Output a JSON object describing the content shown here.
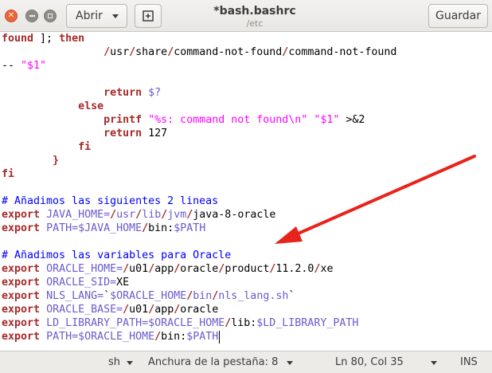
{
  "window": {
    "title": "*bash.bashrc",
    "subtitle": "/etc"
  },
  "header": {
    "open_label": "Abrir",
    "save_label": "Guardar"
  },
  "editor": {
    "lines": [
      [
        [
          "kw",
          "found"
        ],
        [
          "plain",
          " ]; "
        ],
        [
          "kw",
          "then"
        ]
      ],
      [
        [
          "plain",
          "                "
        ],
        [
          "kw",
          "/"
        ],
        [
          "plain",
          "usr"
        ],
        [
          "kw",
          "/"
        ],
        [
          "plain",
          "share"
        ],
        [
          "kw",
          "/"
        ],
        [
          "plain",
          "command-not-found"
        ],
        [
          "kw",
          "/"
        ],
        [
          "plain",
          "command-not-found"
        ]
      ],
      [
        [
          "plain",
          "-- "
        ],
        [
          "str",
          "\"$1\""
        ]
      ],
      [
        [
          "plain",
          ""
        ]
      ],
      [
        [
          "plain",
          "                "
        ],
        [
          "kw",
          "return"
        ],
        [
          "plain",
          " "
        ],
        [
          "var",
          "$?"
        ]
      ],
      [
        [
          "plain",
          "            "
        ],
        [
          "kw",
          "else"
        ]
      ],
      [
        [
          "plain",
          "                "
        ],
        [
          "kw",
          "printf"
        ],
        [
          "plain",
          " "
        ],
        [
          "str",
          "\"%s: command not found\\n\""
        ],
        [
          "plain",
          " "
        ],
        [
          "str",
          "\"$1\""
        ],
        [
          "plain",
          " >&2"
        ]
      ],
      [
        [
          "plain",
          "                "
        ],
        [
          "kw",
          "return"
        ],
        [
          "plain",
          " 127"
        ]
      ],
      [
        [
          "plain",
          "            "
        ],
        [
          "kw",
          "fi"
        ]
      ],
      [
        [
          "plain",
          "        "
        ],
        [
          "kw",
          "}"
        ]
      ],
      [
        [
          "kw",
          "fi"
        ]
      ],
      [
        [
          "plain",
          ""
        ]
      ],
      [
        [
          "cmt",
          "# Añadimos las siguientes 2 lineas"
        ]
      ],
      [
        [
          "kw",
          "export"
        ],
        [
          "plain",
          " "
        ],
        [
          "var",
          "JAVA_HOME="
        ],
        [
          "kw",
          "/"
        ],
        [
          "var",
          "usr"
        ],
        [
          "kw",
          "/"
        ],
        [
          "var",
          "lib"
        ],
        [
          "kw",
          "/"
        ],
        [
          "var",
          "jvm"
        ],
        [
          "kw",
          "/"
        ],
        [
          "plain",
          "java-8-oracle"
        ]
      ],
      [
        [
          "kw",
          "export"
        ],
        [
          "plain",
          " "
        ],
        [
          "var",
          "PATH=$JAVA_HOME"
        ],
        [
          "kw",
          "/"
        ],
        [
          "plain",
          "bin:"
        ],
        [
          "var",
          "$PATH"
        ]
      ],
      [
        [
          "plain",
          ""
        ]
      ],
      [
        [
          "cmt",
          "# Añadimos las variables para Oracle"
        ]
      ],
      [
        [
          "kw",
          "export"
        ],
        [
          "plain",
          " "
        ],
        [
          "var",
          "ORACLE_HOME="
        ],
        [
          "kw",
          "/"
        ],
        [
          "plain",
          "u01"
        ],
        [
          "kw",
          "/"
        ],
        [
          "plain",
          "app"
        ],
        [
          "kw",
          "/"
        ],
        [
          "plain",
          "oracle"
        ],
        [
          "kw",
          "/"
        ],
        [
          "plain",
          "product"
        ],
        [
          "kw",
          "/"
        ],
        [
          "plain",
          "11.2.0"
        ],
        [
          "kw",
          "/"
        ],
        [
          "plain",
          "xe"
        ]
      ],
      [
        [
          "kw",
          "export"
        ],
        [
          "plain",
          " "
        ],
        [
          "var",
          "ORACLE_SID="
        ],
        [
          "plain",
          "XE"
        ]
      ],
      [
        [
          "kw",
          "export"
        ],
        [
          "plain",
          " "
        ],
        [
          "var",
          "NLS_LANG="
        ],
        [
          "plain",
          "`"
        ],
        [
          "var",
          "$ORACLE_HOME"
        ],
        [
          "kw",
          "/"
        ],
        [
          "var",
          "bin"
        ],
        [
          "kw",
          "/"
        ],
        [
          "var",
          "nls_lang.sh"
        ],
        [
          "plain",
          "`"
        ]
      ],
      [
        [
          "kw",
          "export"
        ],
        [
          "plain",
          " "
        ],
        [
          "var",
          "ORACLE_BASE="
        ],
        [
          "kw",
          "/"
        ],
        [
          "plain",
          "u01"
        ],
        [
          "kw",
          "/"
        ],
        [
          "plain",
          "app"
        ],
        [
          "kw",
          "/"
        ],
        [
          "plain",
          "oracle"
        ]
      ],
      [
        [
          "kw",
          "export"
        ],
        [
          "plain",
          " "
        ],
        [
          "var",
          "LD_LIBRARY_PATH=$ORACLE_HOME"
        ],
        [
          "kw",
          "/"
        ],
        [
          "plain",
          "lib:"
        ],
        [
          "var",
          "$LD_LIBRARY_PATH"
        ]
      ],
      [
        [
          "kw",
          "export"
        ],
        [
          "plain",
          " "
        ],
        [
          "var",
          "PATH=$ORACLE_HOME"
        ],
        [
          "kw",
          "/"
        ],
        [
          "plain",
          "bin:"
        ],
        [
          "var",
          "$PATH"
        ]
      ]
    ],
    "colors": {
      "keyword": "#a52a2a",
      "string": "#ff00ff",
      "variable": "#6a5acd",
      "comment": "#0000ff",
      "annotation_arrow": "#e8231b"
    }
  },
  "status": {
    "language": "sh",
    "tab_width": "Anchura de la pestaña: 8",
    "position": "Ln 80, Col 35",
    "mode": "INS"
  },
  "icons": {
    "close": "close-icon",
    "minimize": "minimize-icon",
    "maximize": "maximize-icon",
    "new_tab": "new-tab-icon",
    "dropdown": "chevron-down-icon"
  }
}
